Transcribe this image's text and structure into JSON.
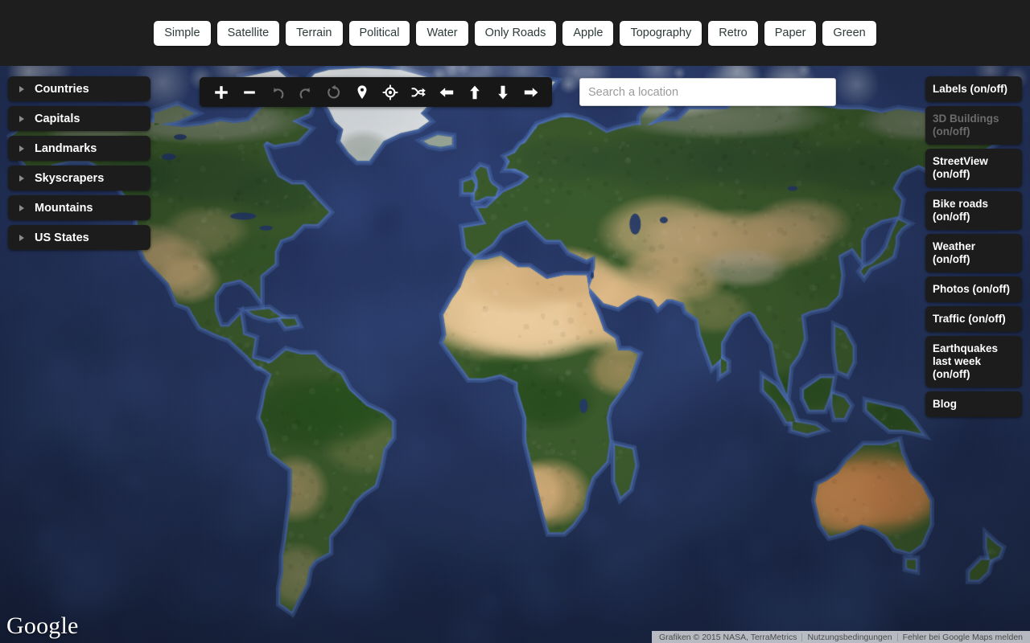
{
  "topbar": {
    "styles": [
      {
        "label": "Simple",
        "name": "style-simple"
      },
      {
        "label": "Satellite",
        "name": "style-satellite"
      },
      {
        "label": "Terrain",
        "name": "style-terrain"
      },
      {
        "label": "Political",
        "name": "style-political"
      },
      {
        "label": "Water",
        "name": "style-water"
      },
      {
        "label": "Only Roads",
        "name": "style-only-roads"
      },
      {
        "label": "Apple",
        "name": "style-apple"
      },
      {
        "label": "Topography",
        "name": "style-topography"
      },
      {
        "label": "Retro",
        "name": "style-retro"
      },
      {
        "label": "Paper",
        "name": "style-paper"
      },
      {
        "label": "Green",
        "name": "style-green"
      }
    ]
  },
  "left_panel": {
    "items": [
      {
        "label": "Countries",
        "name": "sidebar-item-countries"
      },
      {
        "label": "Capitals",
        "name": "sidebar-item-capitals"
      },
      {
        "label": "Landmarks",
        "name": "sidebar-item-landmarks"
      },
      {
        "label": "Skyscrapers",
        "name": "sidebar-item-skyscrapers"
      },
      {
        "label": "Mountains",
        "name": "sidebar-item-mountains"
      },
      {
        "label": "US States",
        "name": "sidebar-item-us-states"
      }
    ]
  },
  "toolbar": {
    "tools": [
      {
        "icon": "plus-icon",
        "title": "Zoom in"
      },
      {
        "icon": "minus-icon",
        "title": "Zoom out"
      },
      {
        "icon": "rotate-left-icon",
        "title": "Rotate left"
      },
      {
        "icon": "rotate-right-icon",
        "title": "Rotate right"
      },
      {
        "icon": "reset-icon",
        "title": "Reset"
      },
      {
        "icon": "map-pin-icon",
        "title": "Place marker"
      },
      {
        "icon": "crosshair-icon",
        "title": "My location"
      },
      {
        "icon": "shuffle-icon",
        "title": "Random location"
      },
      {
        "icon": "arrow-left-icon",
        "title": "Pan left"
      },
      {
        "icon": "arrow-up-icon",
        "title": "Pan up"
      },
      {
        "icon": "arrow-down-icon",
        "title": "Pan down"
      },
      {
        "icon": "arrow-right-icon",
        "title": "Pan right"
      }
    ]
  },
  "search": {
    "placeholder": "Search a location",
    "value": ""
  },
  "right_panel": {
    "items": [
      {
        "label": "Labels (on/off)",
        "name": "toggle-labels",
        "disabled": false
      },
      {
        "label": "3D Buildings (on/off)",
        "name": "toggle-3d-buildings",
        "disabled": true
      },
      {
        "label": "StreetView (on/off)",
        "name": "toggle-streetview",
        "disabled": false
      },
      {
        "label": "Bike roads (on/off)",
        "name": "toggle-bike-roads",
        "disabled": false
      },
      {
        "label": "Weather (on/off)",
        "name": "toggle-weather",
        "disabled": false
      },
      {
        "label": "Photos (on/off)",
        "name": "toggle-photos",
        "disabled": false
      },
      {
        "label": "Traffic (on/off)",
        "name": "toggle-traffic",
        "disabled": false
      },
      {
        "label": "Earthquakes last week (on/off)",
        "name": "toggle-earthquakes",
        "disabled": false
      },
      {
        "label": "Blog",
        "name": "link-blog",
        "disabled": false
      }
    ]
  },
  "map": {
    "logo_text": "Google",
    "attribution": {
      "imagery": "Grafiken © 2015 NASA, TerraMetrics",
      "terms": "Nutzungsbedingungen",
      "report": "Fehler bei Google Maps melden"
    },
    "colors": {
      "ocean_deep": "#1d2d57",
      "ocean_mid": "#2a3b6d",
      "ocean_shallow": "#3a5088",
      "land_green": "#3e5a2d",
      "land_dark_green": "#2c4420",
      "desert": "#d8b07e",
      "desert_light": "#e8cfa3",
      "ice": "#f2f2f2",
      "tundra": "#7d8a64"
    }
  }
}
